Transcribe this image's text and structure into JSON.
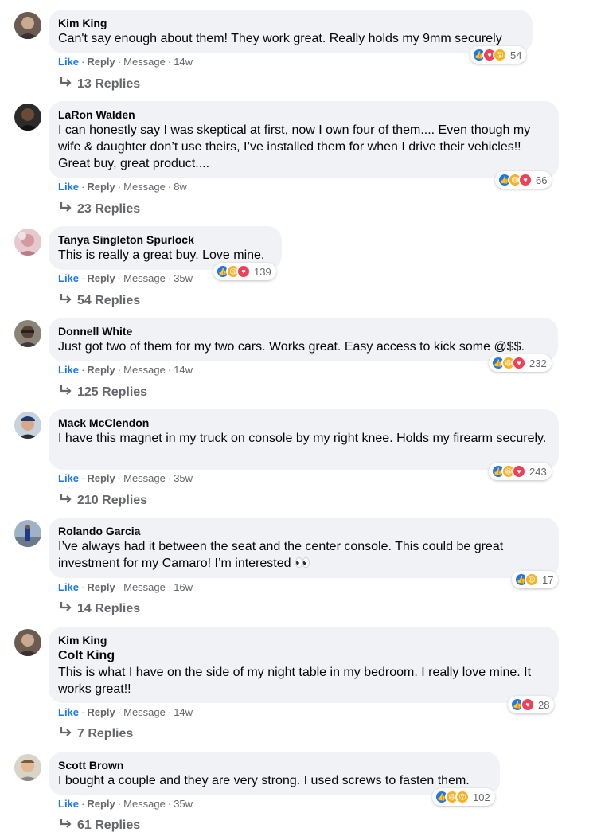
{
  "action_labels": {
    "like": "Like",
    "reply": "Reply",
    "message": "Message",
    "dot": "·"
  },
  "colors": {
    "like_blue": "#1877f2",
    "love_red": "#f33e58",
    "haha_yellow": "#f7b125",
    "bubble_bg": "#f0f2f5",
    "muted": "#65676b"
  },
  "comments": [
    {
      "author": "Kim King",
      "text": "Can't say enough about them! They work great. Really holds my 9mm securely",
      "time": "14w",
      "reactions": [
        "like",
        "love",
        "wow"
      ],
      "count": "54",
      "replies": "13 Replies"
    },
    {
      "author": "LaRon Walden",
      "text": "I can honestly say I was skeptical at first, now I own four of them.... Even though my wife & daughter don’t use theirs, I’ve installed them for when I drive their vehicles!! Great buy, great product....",
      "time": "8w",
      "reactions": [
        "like",
        "haha",
        "love"
      ],
      "count": "66",
      "replies": "23 Replies"
    },
    {
      "author": "Tanya Singleton Spurlock",
      "text": "This is really a great buy. Love mine.",
      "time": "35w",
      "reactions": [
        "like",
        "haha",
        "love"
      ],
      "count": "139",
      "replies": "54 Replies"
    },
    {
      "author": "Donnell White",
      "text": "Just got two of them for my two cars. Works great. Easy access to kick some @$$.",
      "time": "14w",
      "reactions": [
        "like",
        "haha",
        "love"
      ],
      "count": "232",
      "replies": "125 Replies"
    },
    {
      "author": "Mack McClendon",
      "text": "I have this magnet in my truck on console by my right knee. Holds my firearm securely.",
      "time": "35w",
      "reactions": [
        "like",
        "haha",
        "love"
      ],
      "count": "243",
      "replies": "210 Replies"
    },
    {
      "author": "Rolando Garcia",
      "text": "I’ve always had it between the seat and the center console. This could be great investment for my Camaro! I’m interested 👀",
      "time": "16w",
      "reactions": [
        "like",
        "haha"
      ],
      "count": "17",
      "replies": "14 Replies"
    },
    {
      "author": "Kim King",
      "tagged": "Colt King",
      "text": "This is what I have on the side of my night table in my bedroom. I really love mine. It works great!!",
      "time": "14w",
      "reactions": [
        "like",
        "love"
      ],
      "count": "28",
      "replies": "7 Replies"
    },
    {
      "author": "Scott Brown",
      "text": "I bought a couple and they are very strong. I used screws to fasten them.",
      "time": "35w",
      "reactions": [
        "like",
        "haha",
        "wow"
      ],
      "count": "102",
      "replies": "61 Replies"
    }
  ]
}
